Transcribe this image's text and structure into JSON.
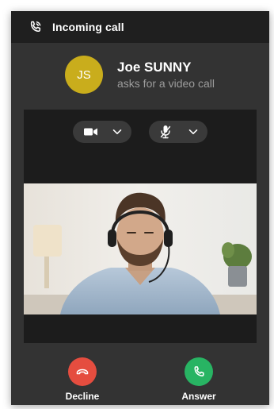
{
  "window": {
    "title": "Incoming call"
  },
  "caller": {
    "initials": "JS",
    "name": "Joe SUNNY",
    "subtitle": "asks for a video call"
  },
  "preview": {
    "camera_icon": "video-camera-icon",
    "microphone_icon": "microphone-muted-icon",
    "dropdown_icon": "chevron-down-icon"
  },
  "actions": {
    "decline_label": "Decline",
    "answer_label": "Answer"
  },
  "colors": {
    "avatar": "#c9ad1c",
    "decline": "#e54d3f",
    "answer": "#28b463",
    "panel": "#333333",
    "titlebar": "#1f1f1f"
  }
}
